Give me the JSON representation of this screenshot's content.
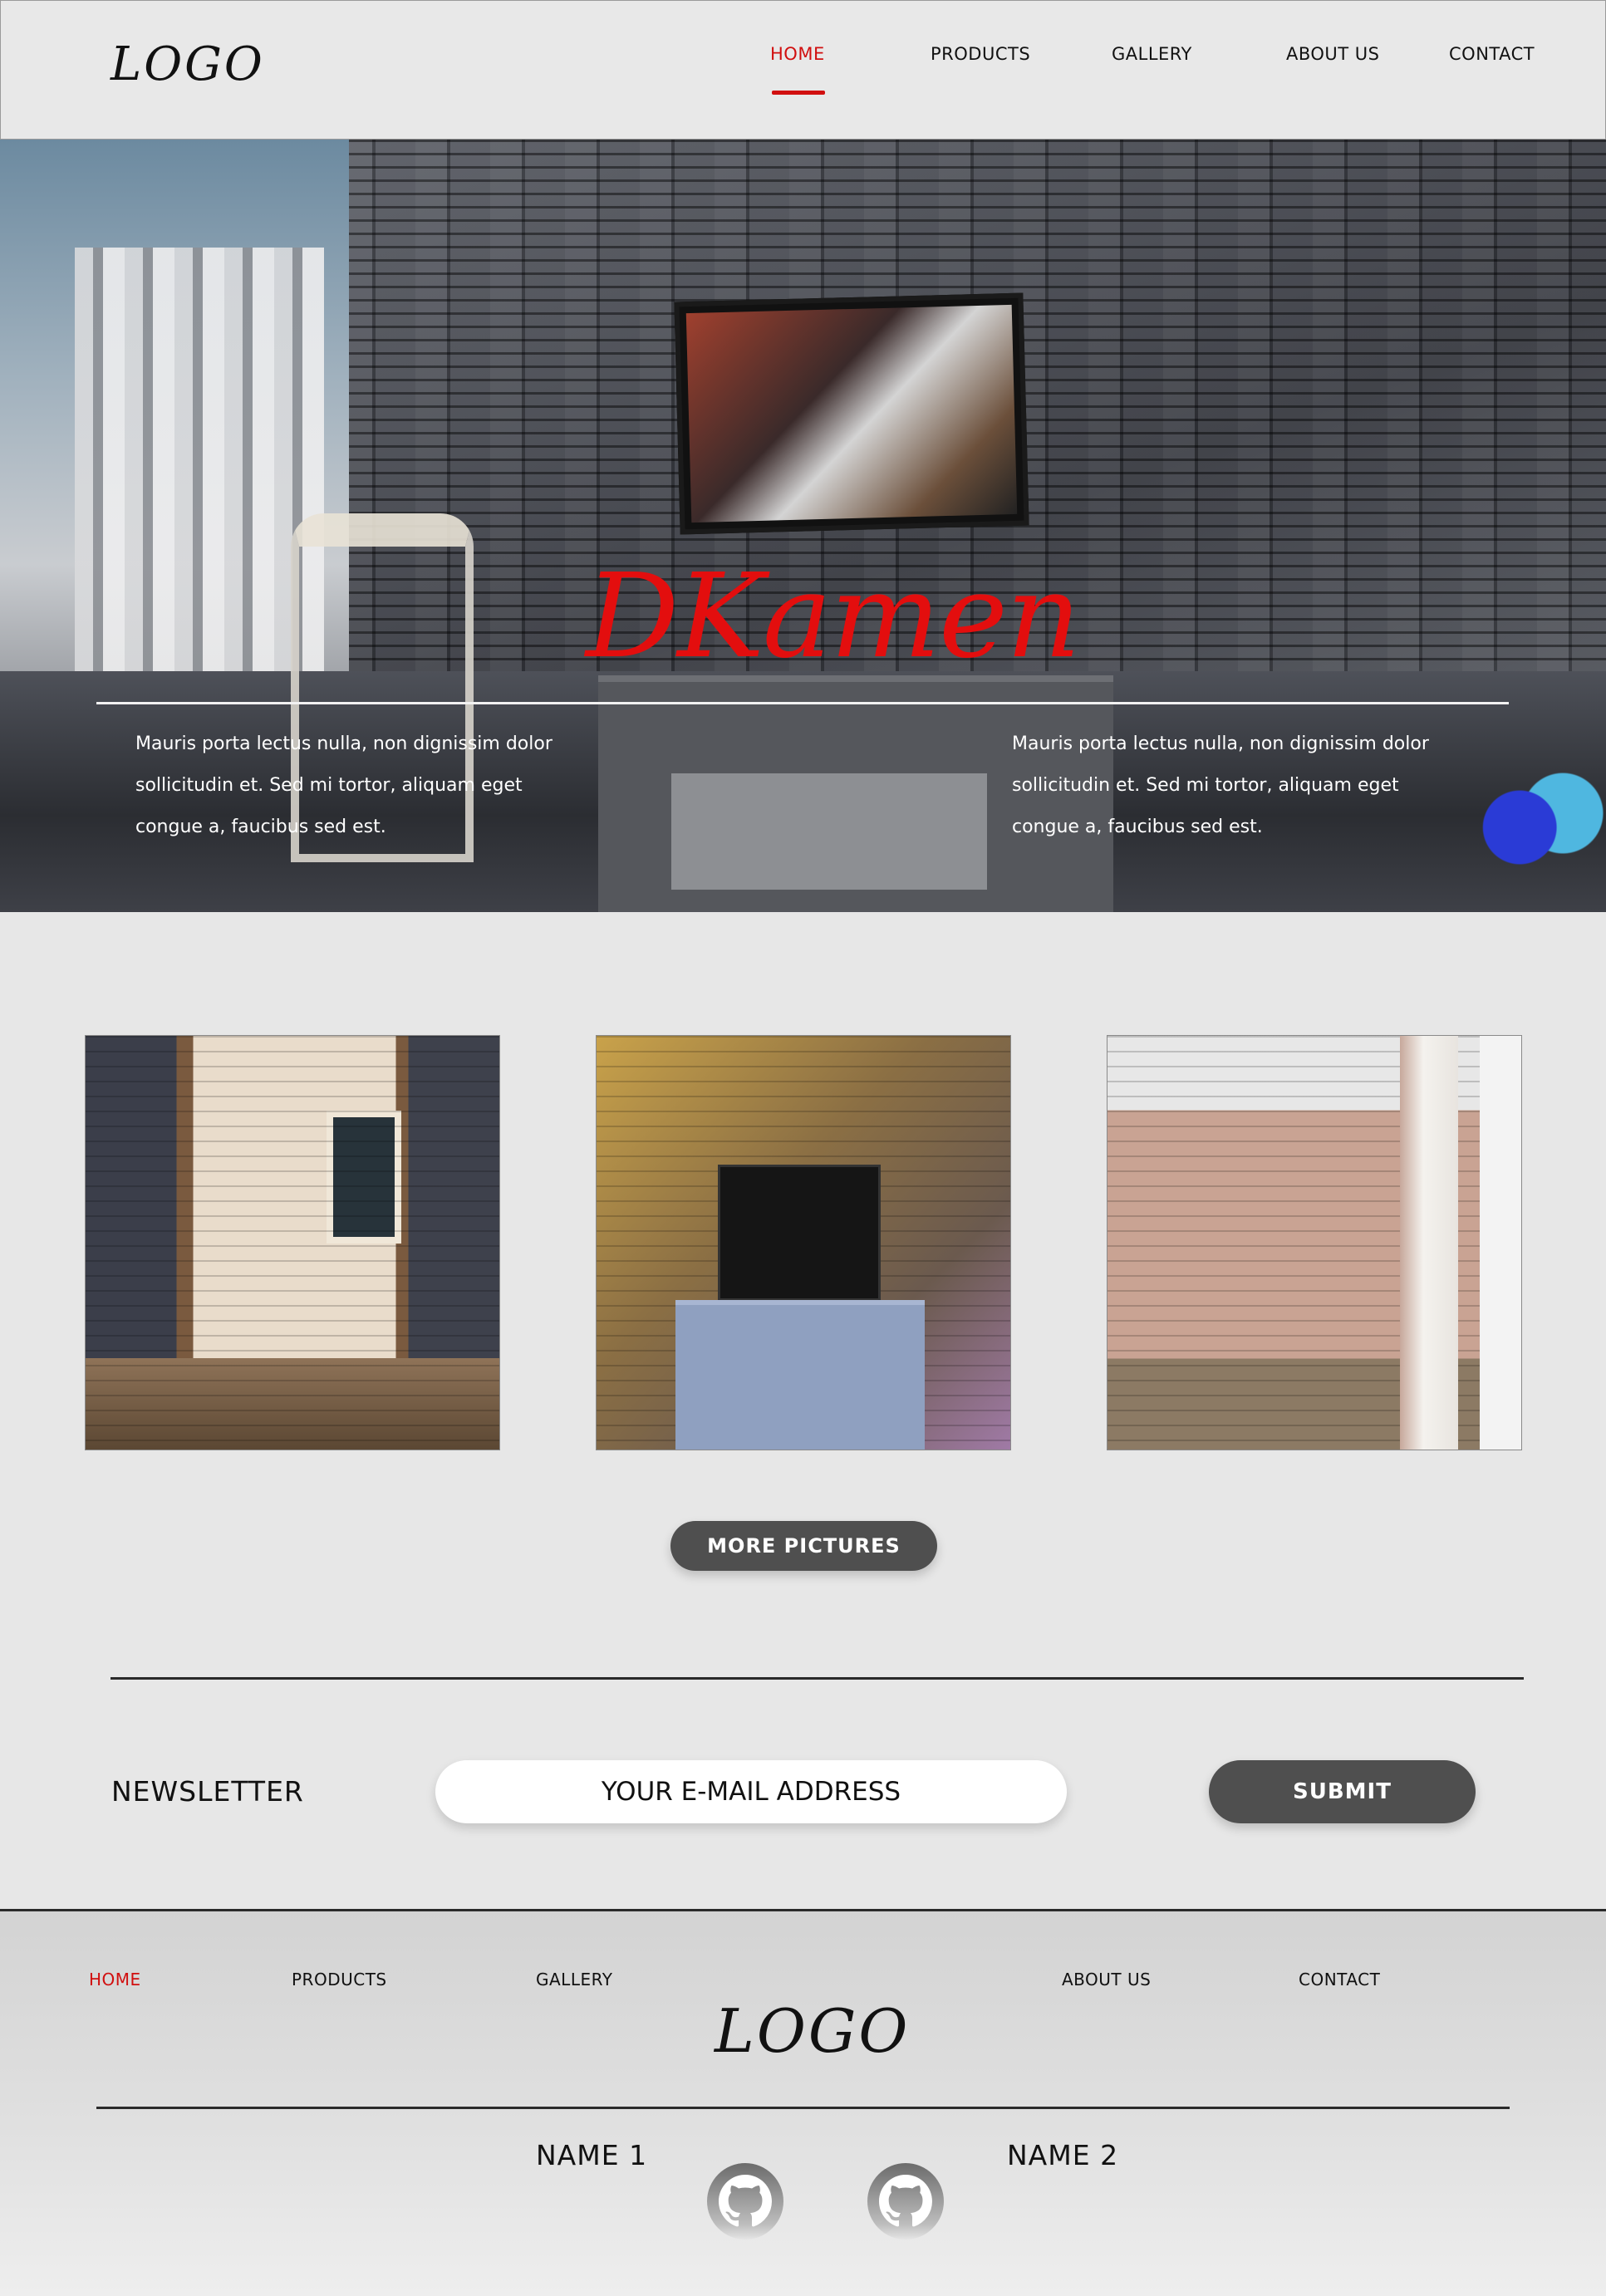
{
  "header": {
    "logo": "LOGO",
    "nav": [
      {
        "label": "HOME",
        "active": true
      },
      {
        "label": "PRODUCTS",
        "active": false
      },
      {
        "label": "GALLERY",
        "active": false
      },
      {
        "label": "ABOUT US",
        "active": false
      },
      {
        "label": "CONTACT",
        "active": false
      }
    ]
  },
  "hero": {
    "title": "DKamen",
    "text_left": "Mauris porta lectus nulla, non dignissim dolor sollicitudin et. Sed mi tortor, aliquam eget congue a, faucibus sed est.",
    "text_right": "Mauris porta lectus nulla, non dignissim dolor sollicitudin et. Sed mi tortor, aliquam eget congue a, faucibus sed est.",
    "title_color": "#e30e0e"
  },
  "gallery": {
    "more_button": "MORE PICTURES"
  },
  "newsletter": {
    "label": "NEWSLETTER",
    "placeholder": "YOUR E-MAIL ADDRESS",
    "submit": "SUBMIT"
  },
  "footer": {
    "logo": "LOGO",
    "nav": [
      {
        "label": "HOME",
        "active": true
      },
      {
        "label": "PRODUCTS",
        "active": false
      },
      {
        "label": "GALLERY",
        "active": false
      },
      {
        "label": "ABOUT US",
        "active": false
      },
      {
        "label": "CONTACT",
        "active": false
      }
    ],
    "names": [
      "NAME 1",
      "NAME 2"
    ],
    "icons": [
      "github-icon",
      "github-icon"
    ]
  },
  "colors": {
    "accent": "#d10f0f",
    "button": "#4f4f4f",
    "background": "#e7e7e7"
  }
}
